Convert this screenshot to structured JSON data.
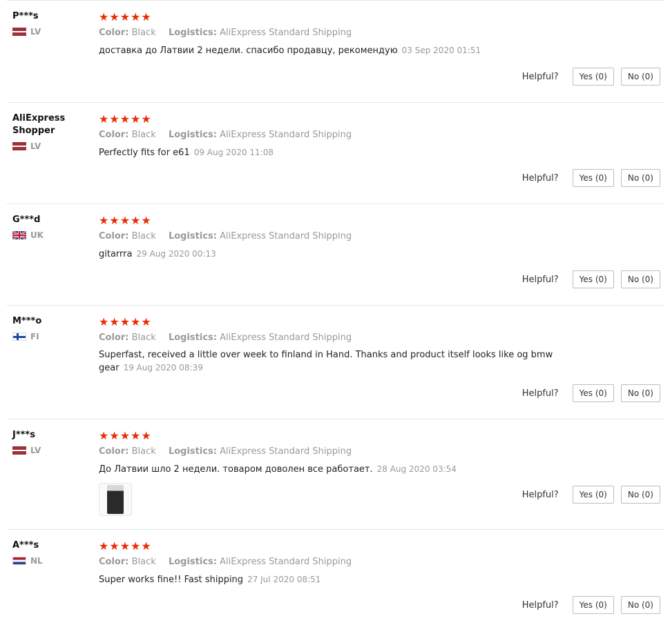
{
  "labels": {
    "color": "Color:",
    "logistics": "Logistics:",
    "helpful": "Helpful?"
  },
  "colors": {
    "star": "#e62e04",
    "muted": "#999999",
    "divider": "#e5e5e5"
  },
  "reviews": [
    {
      "user": "P***s",
      "country": "LV",
      "flag": "latvia-flag",
      "rating": 5,
      "color_value": "Black",
      "logistics_value": "AliExpress Standard Shipping",
      "text": "доставка до Латвии 2 недели. спасибо продавцу, рекомендую",
      "date": "03 Sep 2020 01:51",
      "yes": "Yes (0)",
      "no": "No (0)"
    },
    {
      "user": "AliExpress Shopper",
      "country": "LV",
      "flag": "latvia-flag",
      "rating": 5,
      "color_value": "Black",
      "logistics_value": "AliExpress Standard Shipping",
      "text": "Perfectly fits for e61",
      "date": "09 Aug 2020 11:08",
      "yes": "Yes (0)",
      "no": "No (0)"
    },
    {
      "user": "G***d",
      "country": "UK",
      "flag": "uk-flag",
      "rating": 5,
      "color_value": "Black",
      "logistics_value": "AliExpress Standard Shipping",
      "text": "gitarrra",
      "date": "29 Aug 2020 00:13",
      "yes": "Yes (0)",
      "no": "No (0)"
    },
    {
      "user": "M***o",
      "country": "FI",
      "flag": "finland-flag",
      "rating": 5,
      "color_value": "Black",
      "logistics_value": "AliExpress Standard Shipping",
      "text": "Superfast, received a little over week to finland in Hand. Thanks and product itself looks like og bmw gear",
      "date": "19 Aug 2020 08:39",
      "yes": "Yes (0)",
      "no": "No (0)"
    },
    {
      "user": "J***s",
      "country": "LV",
      "flag": "latvia-flag",
      "rating": 5,
      "color_value": "Black",
      "logistics_value": "AliExpress Standard Shipping",
      "text": "До Латвии шло 2 недели. товаром доволен все работает.",
      "date": "28 Aug 2020 03:54",
      "has_photo": true,
      "yes": "Yes (0)",
      "no": "No (0)"
    },
    {
      "user": "A***s",
      "country": "NL",
      "flag": "netherlands-flag",
      "rating": 5,
      "color_value": "Black",
      "logistics_value": "AliExpress Standard Shipping",
      "text": "Super works fine!! Fast shipping",
      "date": "27 Jul 2020 08:51",
      "yes": "Yes (0)",
      "no": "No (0)"
    }
  ]
}
